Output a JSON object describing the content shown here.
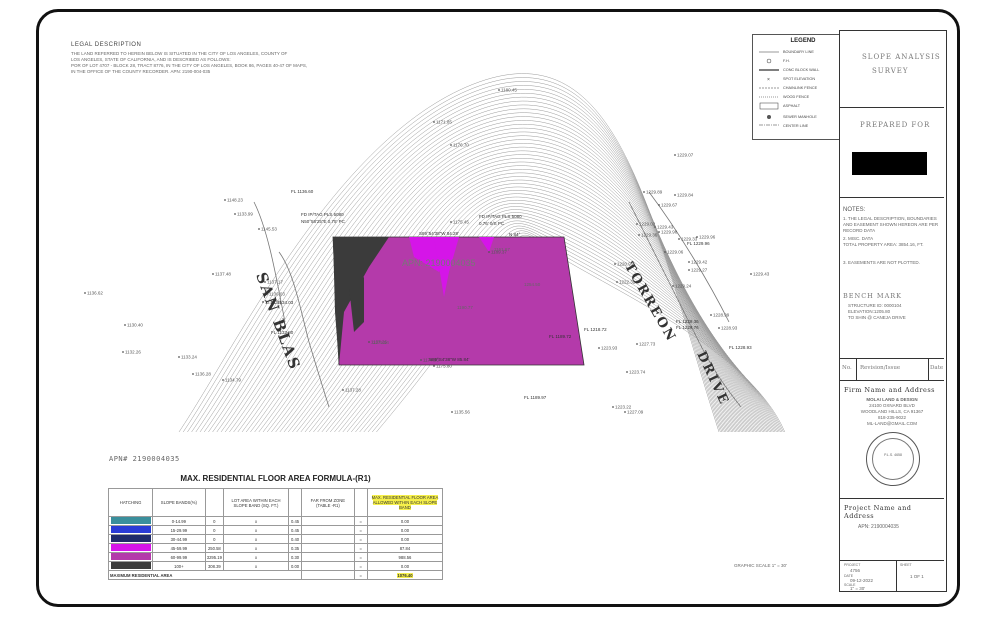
{
  "legal": {
    "title": "LEGAL DESCRIPTION",
    "lines": [
      "THE LAND REFERRED TO HEREIN BELOW IS SITUATED IN THE CITY OF LOS ANGELES, COUNTY OF",
      "LOS ANGELES, STATE OF CALIFORNIA, AND IS DESCRIBED AS FOLLOWS:",
      "POR OF LOT 4707 - BLOCK 28, TRACT 8776, IN THE CITY OF LOS ANGELES, BOOK 86, PAGES 40-47 OF MAPS,",
      "IN THE OFFICE OF THE COUNTY RECORDER. APN: 2190-004-035"
    ]
  },
  "legend": {
    "title": "LEGEND",
    "items": [
      "BOUNDARY LINE",
      "F.H.",
      "CONC BLOCK WALL",
      "SPOT ELEVATION",
      "CHAINLINK FENCE",
      "WOOD FENCE",
      "ASPHALT",
      "SEWER MANHOLE",
      "CENTER LINE"
    ]
  },
  "map": {
    "apn_label": "APN: 2190004035",
    "road_san_blas": "SAN BLAS",
    "road_torreon": "TORREON",
    "road_drive": "DRIVE",
    "found_left": "FD IP/TAG PLS 5080",
    "found_left_2": "N50°58'25\"E 0.75' PC",
    "found_right": "FD IP/TAG PLS 5080",
    "found_right_2": "0.76' 0/S PC",
    "bearing_bottom": "S89°S4'38\"W  85.84'",
    "bearing_top": "S89°54'38\"W  84.29'",
    "spot_elevations": [
      {
        "label": "1180.45"
      },
      {
        "label": "1171.85"
      },
      {
        "label": "1176.70"
      },
      {
        "label": "1229.07"
      },
      {
        "label": "1229.89"
      },
      {
        "label": "1229.84"
      },
      {
        "label": "1229.67"
      },
      {
        "label": "1229.02"
      },
      {
        "label": "1229.43"
      },
      {
        "label": "1229.36"
      },
      {
        "label": "1229.98"
      },
      {
        "label": "1229.33"
      },
      {
        "label": "1229.96"
      },
      {
        "label": "1229.06"
      },
      {
        "label": "1229.42"
      },
      {
        "label": "1229.27"
      },
      {
        "label": "1229.24"
      },
      {
        "label": "1228.99"
      },
      {
        "label": "1228.93"
      },
      {
        "label": "1220.95"
      },
      {
        "label": "1222.32"
      },
      {
        "label": "1227.73"
      },
      {
        "label": "1223.74"
      },
      {
        "label": "1223.93"
      },
      {
        "label": "1223.22"
      },
      {
        "label": "1227.09"
      },
      {
        "label": "1229.43"
      },
      {
        "label": "1148.23"
      },
      {
        "label": "1133.99"
      },
      {
        "label": "1145.53"
      },
      {
        "label": "1137.48"
      },
      {
        "label": "1137.17"
      },
      {
        "label": "1136.03"
      },
      {
        "label": "1135.54"
      },
      {
        "label": "1136.62"
      },
      {
        "label": "1130.40"
      },
      {
        "label": "1133.24"
      },
      {
        "label": "1132.26"
      },
      {
        "label": "1136.28"
      },
      {
        "label": "1134.79"
      },
      {
        "label": "1137.28"
      },
      {
        "label": "1174.93"
      },
      {
        "label": "1175.80"
      },
      {
        "label": "1175.45"
      },
      {
        "label": "1189.37"
      },
      {
        "label": "1137.26"
      },
      {
        "label": "1135.56"
      }
    ],
    "fl_labels": [
      "FL 1136.60",
      "FL 1134.03",
      "FL 1133.80",
      "FL 1189.72",
      "FL 1218.72",
      "FL 1189.97",
      "FL 1229.36",
      "FL 1229.76",
      "FL 1228.93",
      "FL 1229.96"
    ],
    "interior_labels": [
      "1264.59",
      "1190.77",
      "1254.50",
      "1161.67",
      "1175.24",
      "1179.38",
      "1229.36",
      "N 84°"
    ],
    "scale_label": "GRAPHIC SCALE 1\" = 30'"
  },
  "far_table": {
    "apn": "APN# 2190004035",
    "title": "MAX. RESIDENTIAL FLOOR AREA FORMULA-(R1)",
    "headers": [
      "HATCHING",
      "SLOPE BANDS(%)",
      "",
      "LOT AREA WITHIN EACH SLOPE BAND (SQ. FT.)",
      "",
      "FAR FROM ZONE (TABLE -R1)",
      "",
      "MAX. RESIDENTIAL FLOOR AREA ALLOWED WITHIN EACH SLOPE BAND"
    ],
    "rows": [
      {
        "color": "#3a8f9c",
        "band": "0-14.99",
        "area": "0",
        "x": "x",
        "far": "0.45",
        "eq": "=",
        "max": "0.00"
      },
      {
        "color": "#2a3bd6",
        "band": "15-29.99",
        "area": "0",
        "x": "x",
        "far": "0.45",
        "eq": "=",
        "max": "0.00"
      },
      {
        "color": "#1f2a6b",
        "band": "30-44.99",
        "area": "0",
        "x": "x",
        "far": "0.40",
        "eq": "=",
        "max": "0.00"
      },
      {
        "color": "#d515e8",
        "band": "45-59.99",
        "area": "250.58",
        "x": "x",
        "far": "0.35",
        "eq": "=",
        "max": "87.84"
      },
      {
        "color": "#b43aaa",
        "band": "60-99.99",
        "area": "3295.19",
        "x": "x",
        "far": "0.30",
        "eq": "=",
        "max": "988.56"
      },
      {
        "color": "#3b3b3b",
        "band": "100+",
        "area": "308.39",
        "x": "x",
        "far": "0.00",
        "eq": "=",
        "max": "0.00"
      }
    ],
    "total_label": "MAXIMUM RESIDENTIAL AREA",
    "total_eq": "=",
    "total_value": "1076.40"
  },
  "title_block": {
    "title_line1": "SLOPE ANALYSIS",
    "title_line2": "SURVEY",
    "prepared_for": "PREPARED FOR",
    "notes_title": "NOTES:",
    "notes": [
      "1. THE LEGAL DESCRIPTION, BOUNDARIES AND EASEMENT SHOWN HEREON ARE PER RECORD DATA",
      "2. MISC. DATA",
      "TOTAL PROPERTY AREA: 3854.16, FT.",
      "3. EASEMENTS ARE NOT PLOTTED."
    ],
    "bench_mark_title": "BENCH MARK",
    "bench_mark_lines": [
      "STRUCTURE ID: 0000104",
      "ELEVATION:1205.80",
      "TO SHIN @ CANEJA DRIVE"
    ],
    "rev_no": "No.",
    "rev_label": "Revision/Issue",
    "rev_date": "Date",
    "firm_title": "Firm Name and Address",
    "firm_lines": [
      "MOLAI LAND & DESIGN",
      "24100 OXNARD BLVD",
      "WOODLAND HILLS, CA 91367",
      "818-235-9022",
      "ML-LAND@GMAIL.COM"
    ],
    "seal_lines": [
      "P.L.S. 4658",
      "REGISTERED LAND SURVEYOR",
      "STATE OF CALIFORNIA"
    ],
    "project_title": "Project Name and Address",
    "project_apn": "APN: 2190004035",
    "info": [
      {
        "label": "PROJECT",
        "value": "4756"
      },
      {
        "label": "DATE",
        "value": "09-12-2022"
      },
      {
        "label": "SCALE",
        "value": "1\" = 30'"
      },
      {
        "label": "SHEET",
        "value": "1 OF 1"
      }
    ]
  }
}
